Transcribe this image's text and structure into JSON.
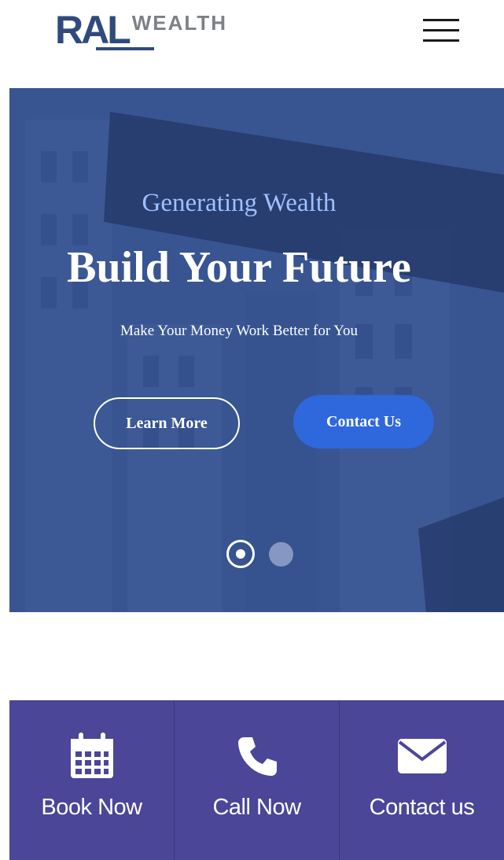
{
  "header": {
    "logo_mark": "RAL",
    "logo_word": "WEALTH",
    "menu_icon": "hamburger-menu-icon"
  },
  "hero": {
    "eyebrow": "Generating Wealth",
    "headline": "Build Your Future",
    "subhead": "Make Your Money Work Better for You",
    "primary_button": "Learn More",
    "secondary_button": "Contact Us",
    "slides_total": 2,
    "active_slide": 1,
    "background": "street-sign-photo"
  },
  "actions": [
    {
      "label": "Book Now",
      "icon": "calendar-icon"
    },
    {
      "label": "Call Now",
      "icon": "phone-icon"
    },
    {
      "label": "Contact us",
      "icon": "envelope-icon"
    }
  ],
  "colors": {
    "brand": "#2f4a7e",
    "accent_button": "#2f67dd",
    "action_bar": "#4b4697",
    "eyebrow": "#9fc0ff"
  }
}
